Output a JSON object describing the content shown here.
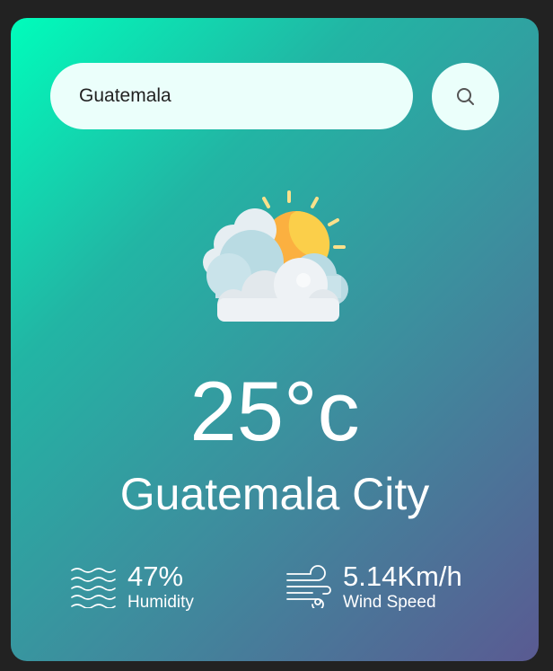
{
  "search": {
    "value": "Guatemala",
    "icon": "search-icon"
  },
  "weather": {
    "icon": "partly-cloudy-icon",
    "temperature": "25°c",
    "city": "Guatemala City"
  },
  "details": {
    "humidity": {
      "icon": "humidity-icon",
      "value": "47%",
      "label": "Humidity"
    },
    "wind": {
      "icon": "wind-icon",
      "value": "5.14Km/h",
      "label": "Wind Speed"
    }
  },
  "colors": {
    "gradient_start": "#00fdbb",
    "gradient_end": "#5a5a92",
    "input_bg": "#ebfffb",
    "page_bg": "#222222"
  }
}
